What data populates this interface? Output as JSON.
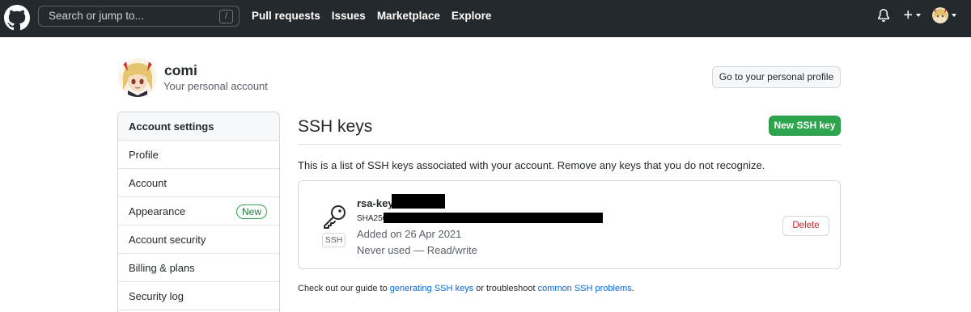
{
  "header": {
    "logo_icon": "github-octocat-icon",
    "search_placeholder": "Search or jump to...",
    "search_shortcut": "/",
    "nav": [
      {
        "label": "Pull requests"
      },
      {
        "label": "Issues"
      },
      {
        "label": "Marketplace"
      },
      {
        "label": "Explore"
      }
    ],
    "notifications_icon": "bell-icon",
    "create_icon": "plus-icon",
    "create_label": "+"
  },
  "account": {
    "name": "comi",
    "subtitle": "Your personal account",
    "profile_button": "Go to your personal profile"
  },
  "sidebar": {
    "heading": "Account settings",
    "items": [
      {
        "label": "Profile"
      },
      {
        "label": "Account"
      },
      {
        "label": "Appearance",
        "badge": "New"
      },
      {
        "label": "Account security"
      },
      {
        "label": "Billing & plans"
      },
      {
        "label": "Security log"
      }
    ]
  },
  "main": {
    "title": "SSH keys",
    "new_button": "New SSH key",
    "description": "This is a list of SSH keys associated with your account. Remove any keys that you do not recognize.",
    "keys": [
      {
        "name": "rsa-key",
        "fingerprint_prefix": "SHA256",
        "type_label": "SSH",
        "added": "Added on 26 Apr 2021",
        "usage": "Never used — Read/write",
        "delete_label": "Delete"
      }
    ],
    "footer": {
      "prefix": "Check out our guide to ",
      "link1": "generating SSH keys",
      "middle": " or troubleshoot ",
      "link2": "common SSH problems",
      "suffix": "."
    }
  },
  "colors": {
    "header_bg": "#24292e",
    "primary_green": "#2da44e",
    "link_blue": "#0969da",
    "danger_red": "#cf222e"
  }
}
